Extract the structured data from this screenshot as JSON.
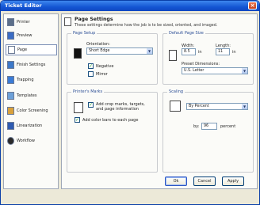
{
  "window": {
    "title": "Ticket Editor",
    "close_glyph": "×"
  },
  "sidebar": {
    "items": [
      {
        "label": "Printer",
        "icon": "printer-icon",
        "color": "#5c6f8a"
      },
      {
        "label": "Preview",
        "icon": "preview-icon",
        "color": "#3b6cc4"
      },
      {
        "label": "Page",
        "icon": "page-icon",
        "color": "#ffffff",
        "selected": true
      },
      {
        "label": "Finish Settings",
        "icon": "finish-icon",
        "color": "#3d78c8"
      },
      {
        "label": "Trapping",
        "icon": "trapping-icon",
        "color": "#3a7bd5"
      },
      {
        "label": "Templates",
        "icon": "templates-icon",
        "color": "#6da0d8"
      },
      {
        "label": "Color Screening",
        "icon": "color-screening-icon",
        "color": "#d9a13c"
      },
      {
        "label": "Linearization",
        "icon": "linearization-icon",
        "color": "#2f5bb1"
      },
      {
        "label": "Workflow",
        "icon": "workflow-icon",
        "color": "#2a2a2a"
      }
    ]
  },
  "page": {
    "heading": "Page Settings",
    "description": "These settings determine how the job is to be sized, oriented, and imaged."
  },
  "page_setup": {
    "title": "Page Setup",
    "orientation_label": "Orientation:",
    "orientation_value": "Short Edge",
    "negative_label": "Negative",
    "mirror_label": "Mirror",
    "negative_checked": true,
    "mirror_checked": false
  },
  "default_page_size": {
    "title": "Default Page Size",
    "width_label": "Width:",
    "width_value": "8.5",
    "length_label": "Length:",
    "length_value": "11",
    "unit": "in",
    "preset_label": "Preset Dimensions:",
    "preset_value": "U.S. Letter"
  },
  "printers_marks": {
    "title": "Printer's Marks",
    "crop_label": "Add crop marks, targets, and page information",
    "color_bars_label": "Add color bars to each page",
    "crop_checked": true,
    "color_bars_checked": true
  },
  "scaling": {
    "title": "Scaling",
    "mode_value": "By Percent",
    "by_label": "by:",
    "percent_value": "96",
    "percent_unit": "percent"
  },
  "buttons": {
    "ok": "Ok",
    "cancel": "Cancel",
    "apply": "Apply"
  },
  "icons": {
    "check_glyph": "✓",
    "arrow_glyph": "▼"
  }
}
